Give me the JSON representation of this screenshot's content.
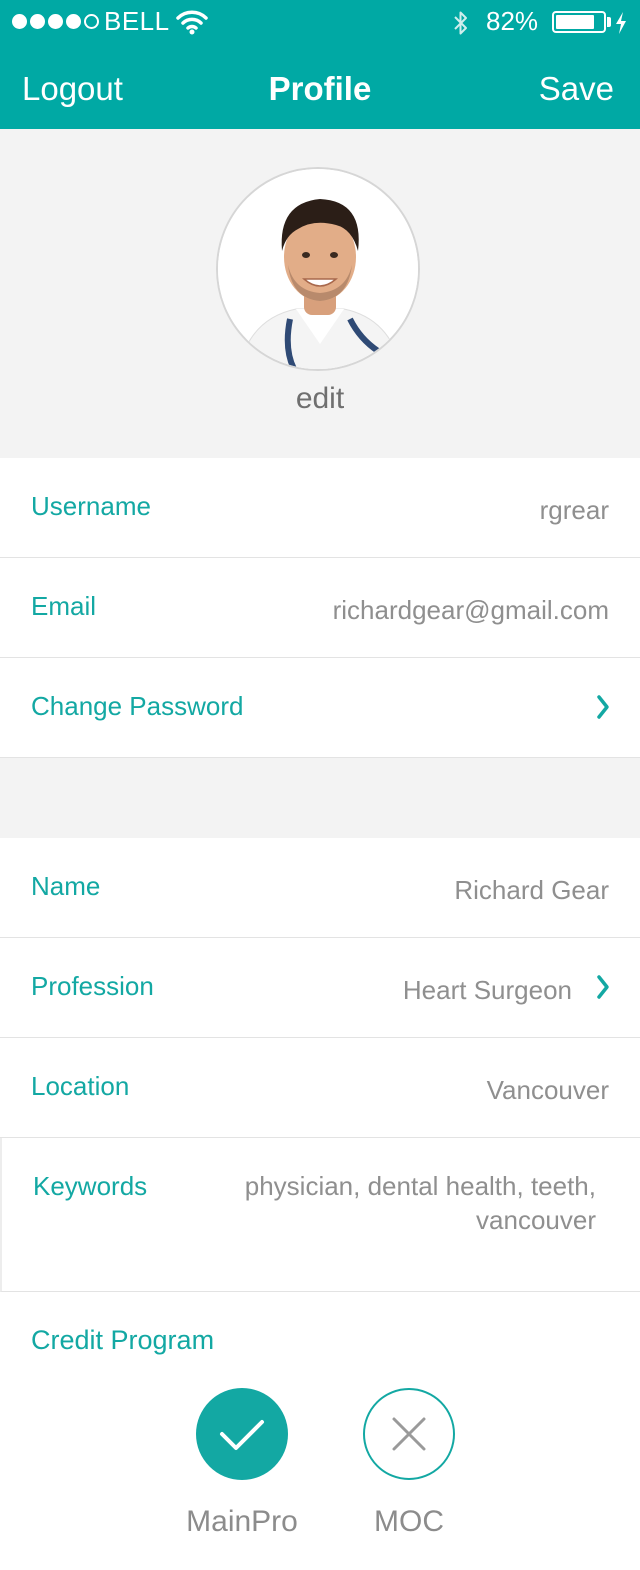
{
  "status_bar": {
    "carrier": "BELL",
    "battery": "82%",
    "battery_level": 0.82,
    "signal_bars_filled": 4,
    "signal_bars_total": 5
  },
  "nav": {
    "left_label": "Logout",
    "title": "Profile",
    "right_label": "Save"
  },
  "avatar": {
    "edit_label": "edit"
  },
  "account": {
    "username_label": "Username",
    "username_value": "rgrear",
    "email_label": "Email",
    "email_value": "richardgear@gmail.com",
    "password_label": "Change Password"
  },
  "profile": {
    "name_label": "Name",
    "name_value": "Richard Gear",
    "profession_label": "Profession",
    "profession_value": "Heart Surgeon",
    "location_label": "Location",
    "location_value": "Vancouver",
    "keywords_label": "Keywords",
    "keywords_value": "physician, dental health, teeth, vancouver"
  },
  "credit": {
    "label": "Credit Program",
    "options": [
      {
        "label": "MainPro",
        "selected": true
      },
      {
        "label": "MOC",
        "selected": false
      }
    ]
  },
  "colors": {
    "accent": "#00a9a4",
    "label_teal": "#13a8a3",
    "value_gray": "#8f8f8f",
    "section_gray": "#f3f3f3"
  }
}
